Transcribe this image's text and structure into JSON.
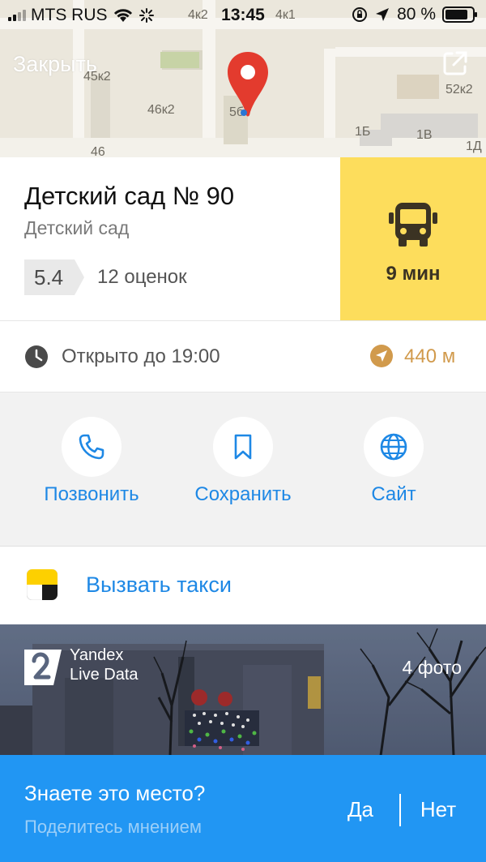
{
  "status_bar": {
    "carrier": "MTS RUS",
    "time": "13:45",
    "battery": "80 %"
  },
  "map": {
    "close_label": "Закрыть",
    "labels": [
      "45к2",
      "46к2",
      "46",
      "4к2",
      "4к1",
      "52к2",
      "1Б",
      "1В",
      "1Д",
      "5б"
    ]
  },
  "place": {
    "title": "Детский сад № 90",
    "category": "Детский сад",
    "rating": "5.4",
    "rating_count": "12 оценок",
    "route_time": "9 мин"
  },
  "hours": {
    "text": "Открыто до 19:00",
    "distance": "440 м"
  },
  "actions": [
    {
      "label": "Позвонить",
      "icon": "phone-icon"
    },
    {
      "label": "Сохранить",
      "icon": "bookmark-icon"
    },
    {
      "label": "Сайт",
      "icon": "globe-icon"
    }
  ],
  "taxi": {
    "label": "Вызвать такси"
  },
  "photo": {
    "brand_line1": "Yandex",
    "brand_line2": "Live Data",
    "count": "4 фото"
  },
  "feedback": {
    "question": "Знаете это место?",
    "hint": "Поделитесь мнением",
    "yes": "Да",
    "no": "Нет"
  },
  "colors": {
    "accent_blue": "#1e88e5",
    "route_yellow": "#fddd5c",
    "feedback_blue": "#2196f3",
    "distance_orange": "#d19a4c"
  }
}
